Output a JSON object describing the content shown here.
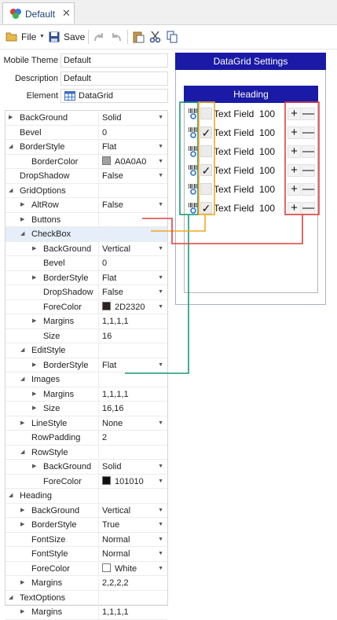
{
  "tab": {
    "label": "Default"
  },
  "toolbar": {
    "file_label": "File",
    "save_label": "Save"
  },
  "form": {
    "mobile_theme": {
      "label": "Mobile Theme",
      "value": "Default"
    },
    "description": {
      "label": "Description",
      "value": "Default"
    },
    "element": {
      "label": "Element",
      "value": "DataGrid"
    }
  },
  "properties": [
    {
      "name": "BackGround",
      "value": "Solid",
      "level": 0,
      "expander": "collapsed",
      "dropdown": true
    },
    {
      "name": "Bevel",
      "value": "0",
      "level": 0,
      "expander": "none",
      "dropdown": false
    },
    {
      "name": "BorderStyle",
      "value": "Flat",
      "level": 0,
      "expander": "expanded",
      "dropdown": true
    },
    {
      "name": "BorderColor",
      "value": "A0A0A0",
      "level": 1,
      "expander": "none",
      "dropdown": true,
      "swatch": "#a0a0a0"
    },
    {
      "name": "DropShadow",
      "value": "False",
      "level": 0,
      "expander": "none",
      "dropdown": true
    },
    {
      "name": "GridOptions",
      "value": "",
      "level": 0,
      "expander": "expanded",
      "dropdown": false
    },
    {
      "name": "AltRow",
      "value": "False",
      "level": 1,
      "expander": "collapsed",
      "dropdown": true
    },
    {
      "name": "Buttons",
      "value": "",
      "level": 1,
      "expander": "collapsed",
      "dropdown": false
    },
    {
      "name": "CheckBox",
      "value": "",
      "level": 1,
      "expander": "expanded",
      "dropdown": false,
      "highlight": true
    },
    {
      "name": "BackGround",
      "value": "Vertical",
      "level": 2,
      "expander": "collapsed",
      "dropdown": true
    },
    {
      "name": "Bevel",
      "value": "0",
      "level": 2,
      "expander": "none",
      "dropdown": false
    },
    {
      "name": "BorderStyle",
      "value": "Flat",
      "level": 2,
      "expander": "collapsed",
      "dropdown": true
    },
    {
      "name": "DropShadow",
      "value": "False",
      "level": 2,
      "expander": "none",
      "dropdown": true
    },
    {
      "name": "ForeColor",
      "value": "2D2320",
      "level": 2,
      "expander": "none",
      "dropdown": true,
      "swatch": "#2d2320"
    },
    {
      "name": "Margins",
      "value": "1,1,1,1",
      "level": 2,
      "expander": "collapsed",
      "dropdown": false
    },
    {
      "name": "Size",
      "value": "16",
      "level": 2,
      "expander": "none",
      "dropdown": false
    },
    {
      "name": "EditStyle",
      "value": "",
      "level": 1,
      "expander": "expanded",
      "dropdown": false
    },
    {
      "name": "BorderStyle",
      "value": "Flat",
      "level": 2,
      "expander": "collapsed",
      "dropdown": true
    },
    {
      "name": "Images",
      "value": "",
      "level": 1,
      "expander": "expanded",
      "dropdown": false
    },
    {
      "name": "Margins",
      "value": "1,1,1,1",
      "level": 2,
      "expander": "collapsed",
      "dropdown": false
    },
    {
      "name": "Size",
      "value": "16,16",
      "level": 2,
      "expander": "collapsed",
      "dropdown": false
    },
    {
      "name": "LineStyle",
      "value": "None",
      "level": 1,
      "expander": "collapsed",
      "dropdown": true
    },
    {
      "name": "RowPadding",
      "value": "2",
      "level": 1,
      "expander": "none",
      "dropdown": false
    },
    {
      "name": "RowStyle",
      "value": "",
      "level": 1,
      "expander": "expanded",
      "dropdown": false
    },
    {
      "name": "BackGround",
      "value": "Solid",
      "level": 2,
      "expander": "collapsed",
      "dropdown": true
    },
    {
      "name": "ForeColor",
      "value": "101010",
      "level": 2,
      "expander": "none",
      "dropdown": true,
      "swatch": "#101010"
    },
    {
      "name": "Heading",
      "value": "",
      "level": 0,
      "expander": "expanded",
      "dropdown": false
    },
    {
      "name": "BackGround",
      "value": "Vertical",
      "level": 1,
      "expander": "collapsed",
      "dropdown": true
    },
    {
      "name": "BorderStyle",
      "value": "True",
      "level": 1,
      "expander": "collapsed",
      "dropdown": true
    },
    {
      "name": "FontSize",
      "value": "Normal",
      "level": 1,
      "expander": "none",
      "dropdown": true
    },
    {
      "name": "FontStyle",
      "value": "Normal",
      "level": 1,
      "expander": "none",
      "dropdown": true
    },
    {
      "name": "ForeColor",
      "value": "White",
      "level": 1,
      "expander": "none",
      "dropdown": true,
      "swatch": "#ffffff"
    },
    {
      "name": "Margins",
      "value": "2,2,2,2",
      "level": 1,
      "expander": "collapsed",
      "dropdown": false
    },
    {
      "name": "TextOptions",
      "value": "",
      "level": 0,
      "expander": "expanded",
      "dropdown": false
    },
    {
      "name": "Margins",
      "value": "1,1,1,1",
      "level": 1,
      "expander": "collapsed",
      "dropdown": false
    }
  ],
  "preview": {
    "title": "DataGrid Settings",
    "heading": "Heading",
    "rows": [
      {
        "checked": false,
        "text": "Text Field",
        "number": "100"
      },
      {
        "checked": true,
        "text": "Text Field",
        "number": "100"
      },
      {
        "checked": false,
        "text": "Text Field",
        "number": "100"
      },
      {
        "checked": true,
        "text": "Text Field",
        "number": "100"
      },
      {
        "checked": false,
        "text": "Text Field",
        "number": "100"
      },
      {
        "checked": true,
        "text": "Text Field",
        "number": "100"
      }
    ],
    "add_symbol": "+",
    "remove_symbol": "—"
  },
  "colors": {
    "header_blue": "#1a1aa6",
    "images_annotation": "#1a9a7a",
    "checkbox_annotation": "#f0a820",
    "buttons_annotation": "#e04040"
  }
}
